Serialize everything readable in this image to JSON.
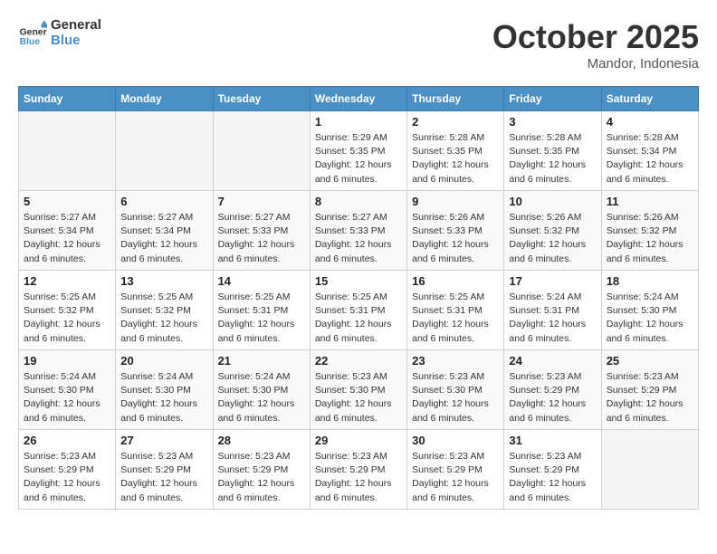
{
  "header": {
    "logo_general": "General",
    "logo_blue": "Blue",
    "month_title": "October 2025",
    "location": "Mandor, Indonesia"
  },
  "days_of_week": [
    "Sunday",
    "Monday",
    "Tuesday",
    "Wednesday",
    "Thursday",
    "Friday",
    "Saturday"
  ],
  "weeks": [
    [
      {
        "day": "",
        "empty": true
      },
      {
        "day": "",
        "empty": true
      },
      {
        "day": "",
        "empty": true
      },
      {
        "day": "1",
        "sunrise": "5:29 AM",
        "sunset": "5:35 PM",
        "daylight": "12 hours and 6 minutes."
      },
      {
        "day": "2",
        "sunrise": "5:28 AM",
        "sunset": "5:35 PM",
        "daylight": "12 hours and 6 minutes."
      },
      {
        "day": "3",
        "sunrise": "5:28 AM",
        "sunset": "5:35 PM",
        "daylight": "12 hours and 6 minutes."
      },
      {
        "day": "4",
        "sunrise": "5:28 AM",
        "sunset": "5:34 PM",
        "daylight": "12 hours and 6 minutes."
      }
    ],
    [
      {
        "day": "5",
        "sunrise": "5:27 AM",
        "sunset": "5:34 PM",
        "daylight": "12 hours and 6 minutes."
      },
      {
        "day": "6",
        "sunrise": "5:27 AM",
        "sunset": "5:34 PM",
        "daylight": "12 hours and 6 minutes."
      },
      {
        "day": "7",
        "sunrise": "5:27 AM",
        "sunset": "5:33 PM",
        "daylight": "12 hours and 6 minutes."
      },
      {
        "day": "8",
        "sunrise": "5:27 AM",
        "sunset": "5:33 PM",
        "daylight": "12 hours and 6 minutes."
      },
      {
        "day": "9",
        "sunrise": "5:26 AM",
        "sunset": "5:33 PM",
        "daylight": "12 hours and 6 minutes."
      },
      {
        "day": "10",
        "sunrise": "5:26 AM",
        "sunset": "5:32 PM",
        "daylight": "12 hours and 6 minutes."
      },
      {
        "day": "11",
        "sunrise": "5:26 AM",
        "sunset": "5:32 PM",
        "daylight": "12 hours and 6 minutes."
      }
    ],
    [
      {
        "day": "12",
        "sunrise": "5:25 AM",
        "sunset": "5:32 PM",
        "daylight": "12 hours and 6 minutes."
      },
      {
        "day": "13",
        "sunrise": "5:25 AM",
        "sunset": "5:32 PM",
        "daylight": "12 hours and 6 minutes."
      },
      {
        "day": "14",
        "sunrise": "5:25 AM",
        "sunset": "5:31 PM",
        "daylight": "12 hours and 6 minutes."
      },
      {
        "day": "15",
        "sunrise": "5:25 AM",
        "sunset": "5:31 PM",
        "daylight": "12 hours and 6 minutes."
      },
      {
        "day": "16",
        "sunrise": "5:25 AM",
        "sunset": "5:31 PM",
        "daylight": "12 hours and 6 minutes."
      },
      {
        "day": "17",
        "sunrise": "5:24 AM",
        "sunset": "5:31 PM",
        "daylight": "12 hours and 6 minutes."
      },
      {
        "day": "18",
        "sunrise": "5:24 AM",
        "sunset": "5:30 PM",
        "daylight": "12 hours and 6 minutes."
      }
    ],
    [
      {
        "day": "19",
        "sunrise": "5:24 AM",
        "sunset": "5:30 PM",
        "daylight": "12 hours and 6 minutes."
      },
      {
        "day": "20",
        "sunrise": "5:24 AM",
        "sunset": "5:30 PM",
        "daylight": "12 hours and 6 minutes."
      },
      {
        "day": "21",
        "sunrise": "5:24 AM",
        "sunset": "5:30 PM",
        "daylight": "12 hours and 6 minutes."
      },
      {
        "day": "22",
        "sunrise": "5:23 AM",
        "sunset": "5:30 PM",
        "daylight": "12 hours and 6 minutes."
      },
      {
        "day": "23",
        "sunrise": "5:23 AM",
        "sunset": "5:30 PM",
        "daylight": "12 hours and 6 minutes."
      },
      {
        "day": "24",
        "sunrise": "5:23 AM",
        "sunset": "5:29 PM",
        "daylight": "12 hours and 6 minutes."
      },
      {
        "day": "25",
        "sunrise": "5:23 AM",
        "sunset": "5:29 PM",
        "daylight": "12 hours and 6 minutes."
      }
    ],
    [
      {
        "day": "26",
        "sunrise": "5:23 AM",
        "sunset": "5:29 PM",
        "daylight": "12 hours and 6 minutes."
      },
      {
        "day": "27",
        "sunrise": "5:23 AM",
        "sunset": "5:29 PM",
        "daylight": "12 hours and 6 minutes."
      },
      {
        "day": "28",
        "sunrise": "5:23 AM",
        "sunset": "5:29 PM",
        "daylight": "12 hours and 6 minutes."
      },
      {
        "day": "29",
        "sunrise": "5:23 AM",
        "sunset": "5:29 PM",
        "daylight": "12 hours and 6 minutes."
      },
      {
        "day": "30",
        "sunrise": "5:23 AM",
        "sunset": "5:29 PM",
        "daylight": "12 hours and 6 minutes."
      },
      {
        "day": "31",
        "sunrise": "5:23 AM",
        "sunset": "5:29 PM",
        "daylight": "12 hours and 6 minutes."
      },
      {
        "day": "",
        "empty": true
      }
    ]
  ]
}
